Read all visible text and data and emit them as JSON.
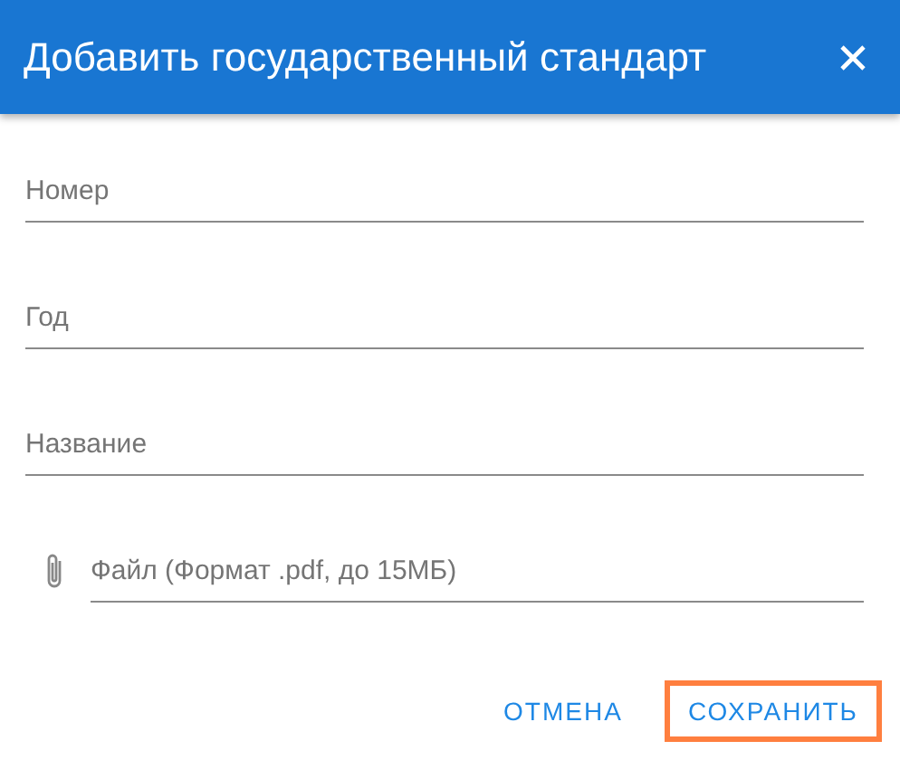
{
  "dialog": {
    "title": "Добавить государственный стандарт"
  },
  "fields": [
    {
      "kind": "text",
      "placeholder": "Номер"
    },
    {
      "kind": "text",
      "placeholder": "Год"
    },
    {
      "kind": "text",
      "placeholder": "Название"
    },
    {
      "kind": "file",
      "placeholder": "Файл (Формат .pdf, до 15МБ)"
    }
  ],
  "buttons": [
    {
      "label": "ОТМЕНА",
      "highlighted": false
    },
    {
      "label": "СОХРАНИТЬ",
      "highlighted": true
    }
  ]
}
